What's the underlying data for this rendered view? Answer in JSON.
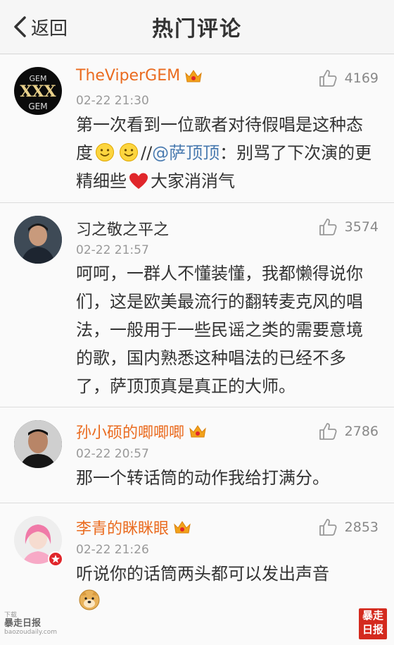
{
  "navbar": {
    "back_label": "返回",
    "title": "热门评论"
  },
  "comments": [
    {
      "username": "TheViperGEM",
      "vip": true,
      "time": "02-22 21:30",
      "likes": "4169",
      "text": {
        "p1": "第一次看到一位歌者对待假唱是这种态度",
        "sep": "//",
        "mention": "@萨顶顶",
        "p2": "：别骂了下次演的更精细些",
        "p3": "大家消消气"
      }
    },
    {
      "username": "习之敬之平之",
      "vip": false,
      "time": "02-22 21:57",
      "likes": "3574",
      "text": "呵呵，一群人不懂装懂，我都懒得说你们，这是欧美最流行的翻转麦克风的唱法，一般用于一些民谣之类的需要意境的歌，国内熟悉这种唱法的已经不多了，萨顶顶真是真正的大师。"
    },
    {
      "username": "孙小硕的唧唧唧",
      "vip": true,
      "time": "02-22 20:57",
      "likes": "2786",
      "text": "那一个转话筒的动作我给打满分。"
    },
    {
      "username": "李青的眯眯眼",
      "vip": true,
      "time": "02-22 21:26",
      "likes": "2853",
      "text": "听说你的话筒两头都可以发出声音"
    }
  ],
  "avatar_texts": {
    "gem_top": "GEM",
    "gem_mid": "XXX",
    "gem_bottom": "GEM"
  },
  "watermark": {
    "left_small": "下载",
    "left_big": "暴走日报",
    "left_url": "baozoudaily.com",
    "right_text": "暴走日报"
  },
  "colors": {
    "vip_name": "#ea6b1f",
    "mention": "#4a7bb0",
    "crown": "#f2a21a",
    "heart": "#e0262b"
  },
  "icons": [
    "back-chevron-icon",
    "thumbs-up-icon",
    "crown-icon",
    "smile-emoji-icon",
    "heart-icon",
    "doge-emoji-icon"
  ]
}
